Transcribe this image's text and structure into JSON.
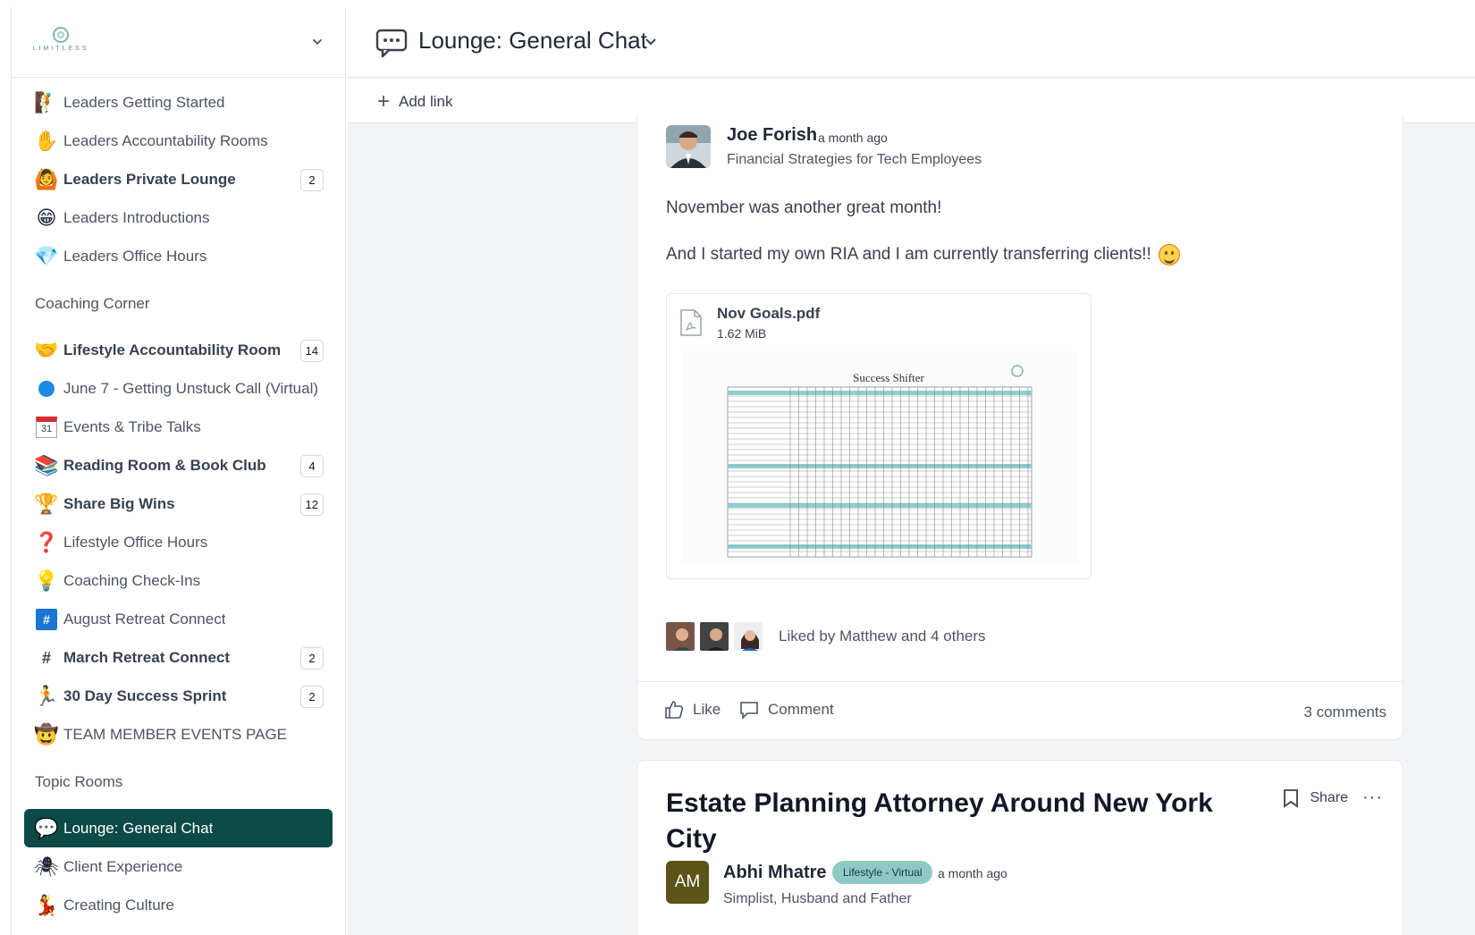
{
  "brand": {
    "logo_text": "LIMITLESS"
  },
  "sidebar": {
    "items_top": [
      {
        "label": "Leaders Getting Started",
        "icon": "climber-icon",
        "glyph": "🧗",
        "bold": false,
        "badge": ""
      },
      {
        "label": "Leaders Accountability Rooms",
        "icon": "hand-icon",
        "glyph": "✋",
        "bold": false,
        "badge": ""
      },
      {
        "label": "Leaders Private Lounge",
        "icon": "hug-icon",
        "glyph": "🙆",
        "bold": true,
        "badge": "2"
      },
      {
        "label": "Leaders Introductions",
        "icon": "grin-icon",
        "glyph": "😁",
        "bold": false,
        "badge": ""
      },
      {
        "label": "Leaders Office Hours",
        "icon": "gem-icon",
        "glyph": "💎",
        "bold": false,
        "badge": ""
      }
    ],
    "section_coaching": "Coaching Corner",
    "items_coaching": [
      {
        "label": "Lifestyle Accountability Room",
        "icon": "handshake-icon",
        "glyph": "🤝",
        "bold": true,
        "badge": "14"
      },
      {
        "label": "June 7 - Getting Unstuck Call (Virtual)",
        "icon": "blue-dot-icon",
        "glyph": "",
        "bold": false,
        "badge": ""
      },
      {
        "label": "Events & Tribe Talks",
        "icon": "calendar-icon",
        "glyph": "31",
        "bold": false,
        "badge": ""
      },
      {
        "label": "Reading Room & Book Club",
        "icon": "books-icon",
        "glyph": "📚",
        "bold": true,
        "badge": "4"
      },
      {
        "label": "Share Big Wins",
        "icon": "trophy-icon",
        "glyph": "🏆",
        "bold": true,
        "badge": "12"
      },
      {
        "label": "Lifestyle Office Hours",
        "icon": "question-icon",
        "glyph": "❓",
        "bold": false,
        "badge": ""
      },
      {
        "label": "Coaching Check-Ins",
        "icon": "lightbulb-icon",
        "glyph": "💡",
        "bold": false,
        "badge": ""
      },
      {
        "label": "August Retreat Connect",
        "icon": "hash-box-icon",
        "glyph": "#",
        "bold": false,
        "badge": ""
      },
      {
        "label": "March Retreat Connect",
        "icon": "hash-icon",
        "glyph": "#",
        "bold": true,
        "badge": "2"
      },
      {
        "label": "30 Day Success Sprint",
        "icon": "runner-icon",
        "glyph": "🏃",
        "bold": true,
        "badge": "2"
      },
      {
        "label": "TEAM MEMBER EVENTS PAGE",
        "icon": "cowboy-icon",
        "glyph": "🤠",
        "bold": false,
        "badge": ""
      }
    ],
    "section_topic": "Topic Rooms",
    "items_topic": [
      {
        "label": "Lounge: General Chat",
        "icon": "chat-bubble-icon",
        "glyph": "💬",
        "bold": false,
        "badge": "",
        "active": true
      },
      {
        "label": "Client Experience",
        "icon": "spider-icon",
        "glyph": "🕷",
        "bold": false,
        "badge": ""
      },
      {
        "label": "Creating Culture",
        "icon": "dancer-icon",
        "glyph": "💃",
        "bold": false,
        "badge": ""
      }
    ]
  },
  "channel": {
    "title": "Lounge: General Chat",
    "add_link": "Add link"
  },
  "post1": {
    "author": "Joe Forish",
    "time": "a month ago",
    "subtitle": "Financial Strategies for Tech Employees",
    "paragraph1": "November was another great month!",
    "paragraph2": "And I started my own RIA and I am currently transferring clients!!",
    "attachment": {
      "name": "Nov Goals.pdf",
      "size": "1.62 MiB",
      "preview_title": "Success Shifter"
    },
    "likes_text": "Liked by Matthew and 4 others",
    "like_label": "Like",
    "comment_label": "Comment",
    "comments_count": "3 comments"
  },
  "post2": {
    "title": "Estate Planning Attorney Around New York City",
    "share_label": "Share",
    "author": "Abhi Mhatre",
    "initials": "AM",
    "tag": "Lifestyle - Virtual",
    "time": "a month ago",
    "subtitle": "Simplist, Husband and Father"
  },
  "colors": {
    "accent": "#0b4a47",
    "tag_bg": "#8fc9c4",
    "avatar_am": "#5b5318"
  }
}
